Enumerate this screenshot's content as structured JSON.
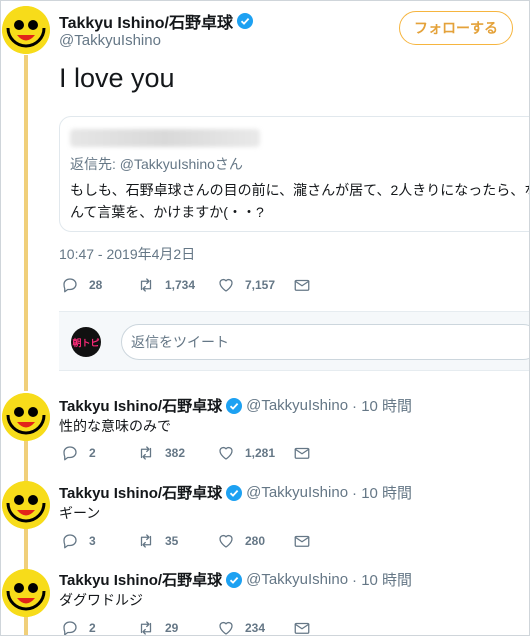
{
  "main_tweet": {
    "name": "Takkyu Ishino/石野卓球",
    "handle": "@TakkyuIshino",
    "follow_label": "フォローする",
    "text": "I love you",
    "quote": {
      "reply_to": "返信先: @TakkyuIshinoさん",
      "text": "もしも、石野卓球さんの目の前に、瀧さんが居て、2人きりになったら、なんて言葉を、かけますか(・・?"
    },
    "timestamp": "10:47 - 2019年4月2日",
    "stats": {
      "replies": "28",
      "retweets": "1,734",
      "likes": "7,157"
    }
  },
  "reply_box": {
    "placeholder": "返信をツイート",
    "avatar_text": "朝トピ"
  },
  "replies": [
    {
      "name": "Takkyu Ishino/石野卓球",
      "handle": "@TakkyuIshino",
      "time": "· 10 時間",
      "text": "性的な意味のみで",
      "replies": "2",
      "retweets": "382",
      "likes": "1,281"
    },
    {
      "name": "Takkyu Ishino/石野卓球",
      "handle": "@TakkyuIshino",
      "time": "· 10 時間",
      "text": "ギーン",
      "replies": "3",
      "retweets": "35",
      "likes": "280"
    },
    {
      "name": "Takkyu Ishino/石野卓球",
      "handle": "@TakkyuIshino",
      "time": "· 10 時間",
      "text": "ダグワドルジ",
      "replies": "2",
      "retweets": "29",
      "likes": "234"
    }
  ],
  "colors": {
    "accent": "#f6b53f",
    "verified": "#1da1f2",
    "thread_line": "#f0cf7a",
    "avatar_bg": "#f7dc1a"
  }
}
